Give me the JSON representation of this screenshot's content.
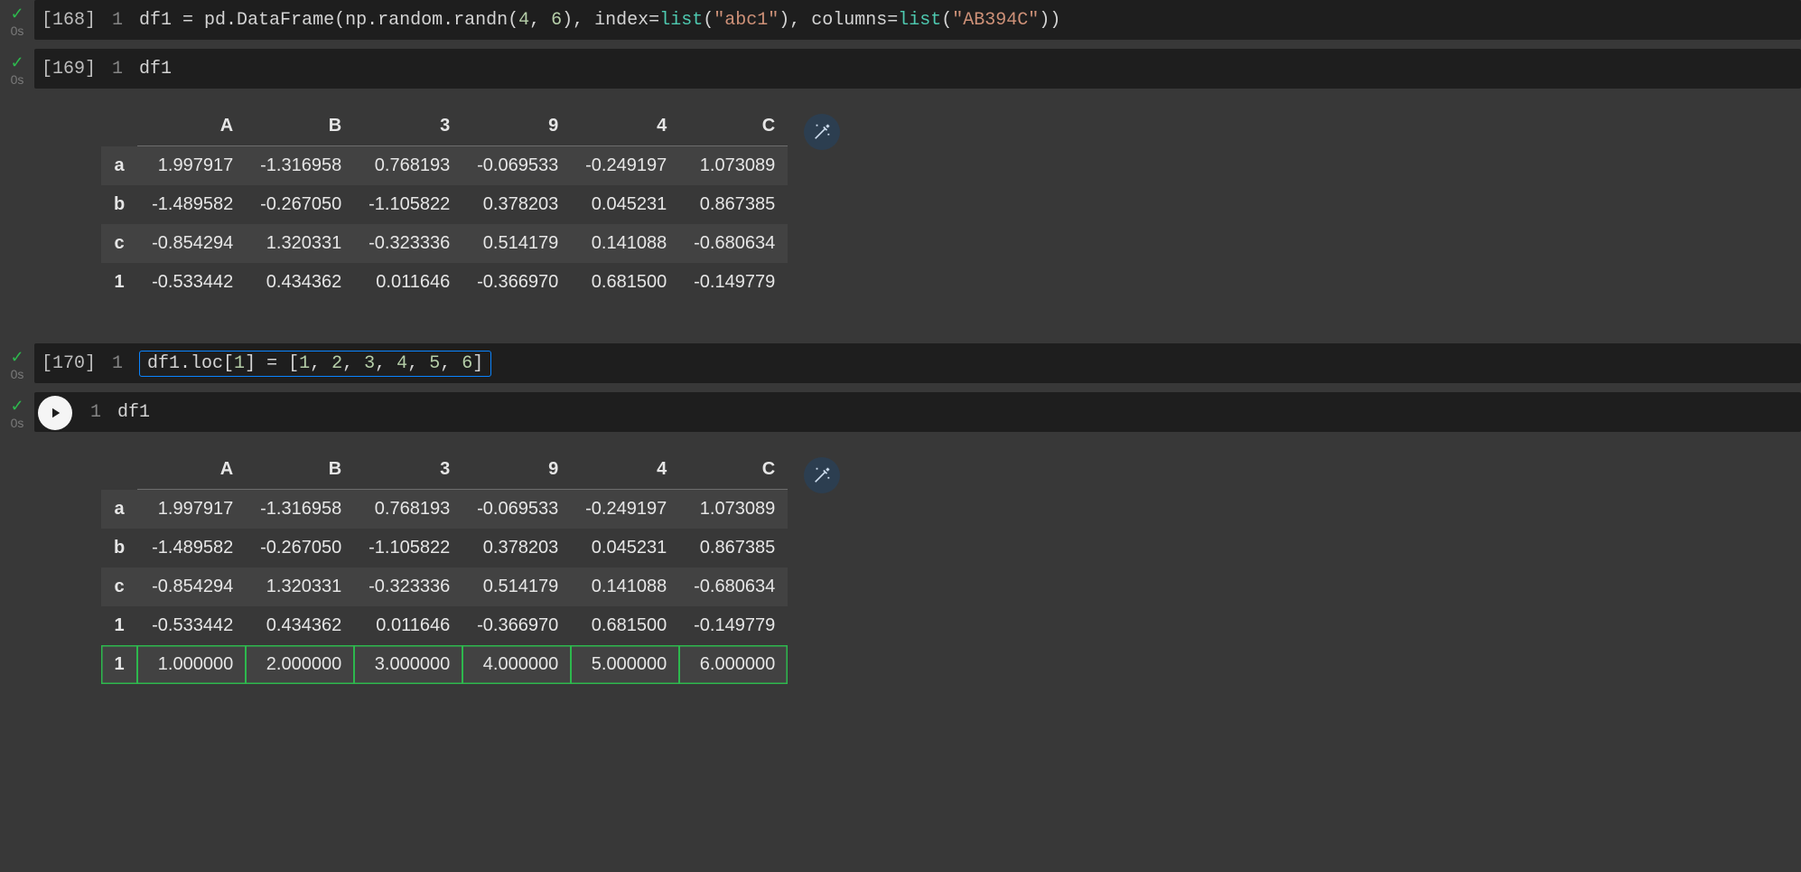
{
  "cells": [
    {
      "exec": "[168]",
      "time": "0s",
      "status": "ok",
      "line": "1",
      "code_html": "df1 = pd.DataFrame(np.random.randn(<span class='num'>4</span>, <span class='num'>6</span>), index=<span class='fn'>list</span>(<span class='str'>\"abc1\"</span>), columns=<span class='fn'>list</span>(<span class='str'>\"AB394C\"</span>))"
    },
    {
      "exec": "[169]",
      "time": "0s",
      "status": "ok",
      "line": "1",
      "code_html": "df1"
    },
    {
      "exec": "[170]",
      "time": "0s",
      "status": "ok",
      "line": "1",
      "boxed": true,
      "code_html": "df1.loc[<span class='num'>1</span>] = [<span class='num'>1</span>, <span class='num'>2</span>, <span class='num'>3</span>, <span class='num'>4</span>, <span class='num'>5</span>, <span class='num'>6</span>]"
    },
    {
      "exec": "",
      "time": "0s",
      "status": "ok",
      "line": "1",
      "run_button": true,
      "code_html": "df1"
    }
  ],
  "outputs": {
    "table1": {
      "columns": [
        "A",
        "B",
        "3",
        "9",
        "4",
        "C"
      ],
      "rows": [
        {
          "idx": "a",
          "vals": [
            "1.997917",
            "-1.316958",
            "0.768193",
            "-0.069533",
            "-0.249197",
            "1.073089"
          ]
        },
        {
          "idx": "b",
          "vals": [
            "-1.489582",
            "-0.267050",
            "-1.105822",
            "0.378203",
            "0.045231",
            "0.867385"
          ]
        },
        {
          "idx": "c",
          "vals": [
            "-0.854294",
            "1.320331",
            "-0.323336",
            "0.514179",
            "0.141088",
            "-0.680634"
          ]
        },
        {
          "idx": "1",
          "vals": [
            "-0.533442",
            "0.434362",
            "0.011646",
            "-0.366970",
            "0.681500",
            "-0.149779"
          ]
        }
      ]
    },
    "table2": {
      "columns": [
        "A",
        "B",
        "3",
        "9",
        "4",
        "C"
      ],
      "rows": [
        {
          "idx": "a",
          "vals": [
            "1.997917",
            "-1.316958",
            "0.768193",
            "-0.069533",
            "-0.249197",
            "1.073089"
          ]
        },
        {
          "idx": "b",
          "vals": [
            "-1.489582",
            "-0.267050",
            "-1.105822",
            "0.378203",
            "0.045231",
            "0.867385"
          ]
        },
        {
          "idx": "c",
          "vals": [
            "-0.854294",
            "1.320331",
            "-0.323336",
            "0.514179",
            "0.141088",
            "-0.680634"
          ]
        },
        {
          "idx": "1",
          "vals": [
            "-0.533442",
            "0.434362",
            "0.011646",
            "-0.366970",
            "0.681500",
            "-0.149779"
          ]
        },
        {
          "idx": "1",
          "vals": [
            "1.000000",
            "2.000000",
            "3.000000",
            "4.000000",
            "5.000000",
            "6.000000"
          ],
          "highlight": true
        }
      ]
    }
  },
  "icons": {
    "check": "✓"
  },
  "chart_data": [
    {
      "type": "table",
      "title": "df1",
      "columns": [
        "",
        "A",
        "B",
        "3",
        "9",
        "4",
        "C"
      ],
      "rows": [
        [
          "a",
          1.997917,
          -1.316958,
          0.768193,
          -0.069533,
          -0.249197,
          1.073089
        ],
        [
          "b",
          -1.489582,
          -0.26705,
          -1.105822,
          0.378203,
          0.045231,
          0.867385
        ],
        [
          "c",
          -0.854294,
          1.320331,
          -0.323336,
          0.514179,
          0.141088,
          -0.680634
        ],
        [
          "1",
          -0.533442,
          0.434362,
          0.011646,
          -0.36697,
          0.6815,
          -0.149779
        ]
      ]
    },
    {
      "type": "table",
      "title": "df1 (after loc assignment)",
      "columns": [
        "",
        "A",
        "B",
        "3",
        "9",
        "4",
        "C"
      ],
      "rows": [
        [
          "a",
          1.997917,
          -1.316958,
          0.768193,
          -0.069533,
          -0.249197,
          1.073089
        ],
        [
          "b",
          -1.489582,
          -0.26705,
          -1.105822,
          0.378203,
          0.045231,
          0.867385
        ],
        [
          "c",
          -0.854294,
          1.320331,
          -0.323336,
          0.514179,
          0.141088,
          -0.680634
        ],
        [
          "1",
          -0.533442,
          0.434362,
          0.011646,
          -0.36697,
          0.6815,
          -0.149779
        ],
        [
          "1",
          1.0,
          2.0,
          3.0,
          4.0,
          5.0,
          6.0
        ]
      ]
    }
  ]
}
